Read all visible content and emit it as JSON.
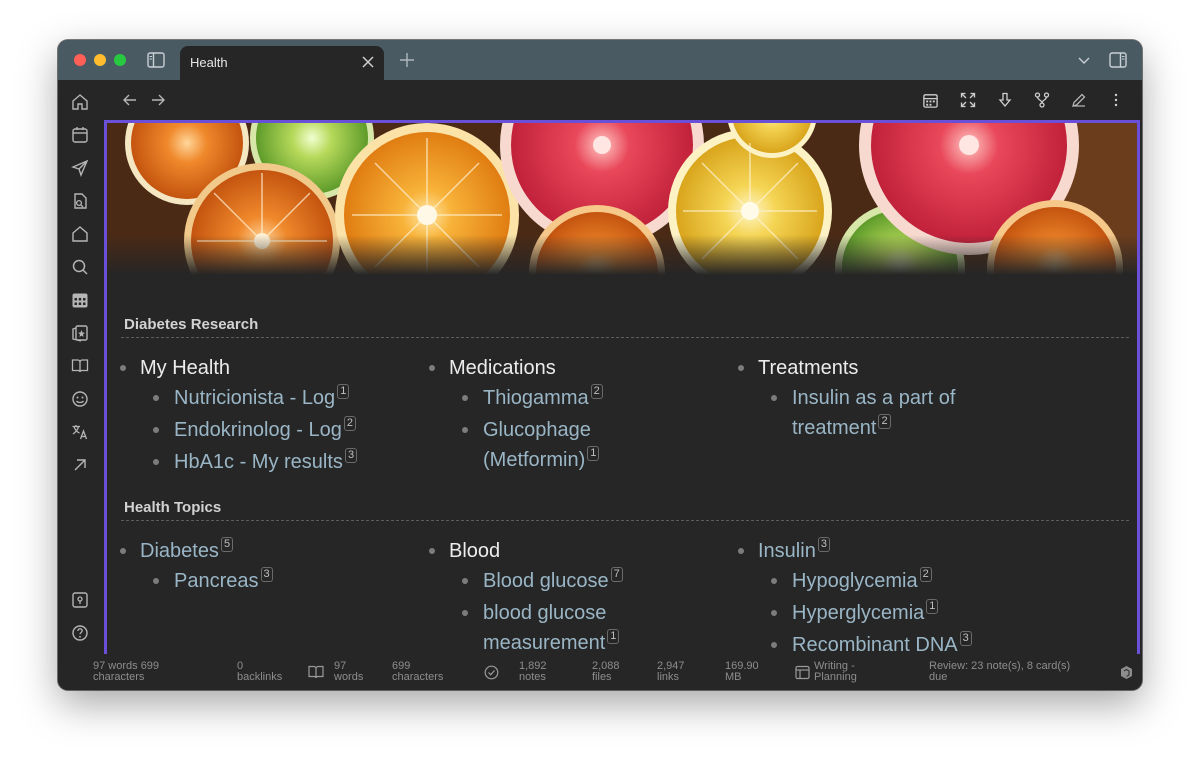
{
  "tab": {
    "title": "Health"
  },
  "colors": {
    "accent": "#6a4fd8",
    "link": "#9ab6c6",
    "titlebar": "#4a5a63",
    "background": "#262626"
  },
  "ribbon_icons": [
    "home-icon",
    "calendar-icon",
    "send-icon",
    "file-search-icon",
    "home-outline-icon",
    "search-icon",
    "calendar-grid-icon",
    "cards-icon",
    "book-icon",
    "smiley-icon",
    "translate-icon",
    "arrow-up-right-icon",
    "vault-icon",
    "help-icon"
  ],
  "sections": [
    {
      "title": "Diabetes Research",
      "columns": [
        {
          "title": "My Health",
          "title_badge": "",
          "items": [
            {
              "label": "Nutricionista - Log",
              "badge": "1"
            },
            {
              "label": "Endokrinolog - Log",
              "badge": "2"
            },
            {
              "label": "HbA1c - My results",
              "badge": "3"
            }
          ]
        },
        {
          "title": "Medications",
          "title_badge": "",
          "items": [
            {
              "label": "Thiogamma",
              "badge": "2"
            },
            {
              "label_line1": "Glucophage",
              "label_line2": "(Metformin)",
              "badge": "1"
            }
          ]
        },
        {
          "title": "Treatments",
          "title_badge": "",
          "items": [
            {
              "label_line1": "Insulin as a part of",
              "label_line2": "treatment",
              "badge": "2"
            }
          ]
        }
      ]
    },
    {
      "title": "Health Topics",
      "columns": [
        {
          "title": "Diabetes",
          "title_badge": "5",
          "items": [
            {
              "label": "Pancreas",
              "badge": "3"
            }
          ]
        },
        {
          "title": "Blood",
          "title_badge": "",
          "items": [
            {
              "label": "Blood glucose",
              "badge": "7"
            },
            {
              "label_line1": "blood glucose",
              "label_line2": "measurement",
              "badge": "1"
            }
          ]
        },
        {
          "title": "Insulin",
          "title_badge": "3",
          "items": [
            {
              "label": "Hypoglycemia",
              "badge": "2"
            },
            {
              "label": "Hyperglycemia",
              "badge": "1"
            },
            {
              "label": "Recombinant DNA",
              "badge": "3"
            }
          ]
        }
      ]
    }
  ],
  "status": {
    "words_chars_1": "97 words 699",
    "words_chars_2": "characters",
    "backlinks_1": "0",
    "backlinks_2": "backlinks",
    "words_1": "97",
    "words_2": "words",
    "chars_1": "699",
    "chars_2": "characters",
    "notes_1": "1,892",
    "notes_2": "notes",
    "files_1": "2,088",
    "files_2": "files",
    "links_1": "2,947",
    "links_2": "links",
    "size_1": "169.90",
    "size_2": "MB",
    "workspace_1": "Writing -",
    "workspace_2": "Planning",
    "review_1": "Review: 23 note(s), 8 card(s)",
    "review_2": "due"
  }
}
